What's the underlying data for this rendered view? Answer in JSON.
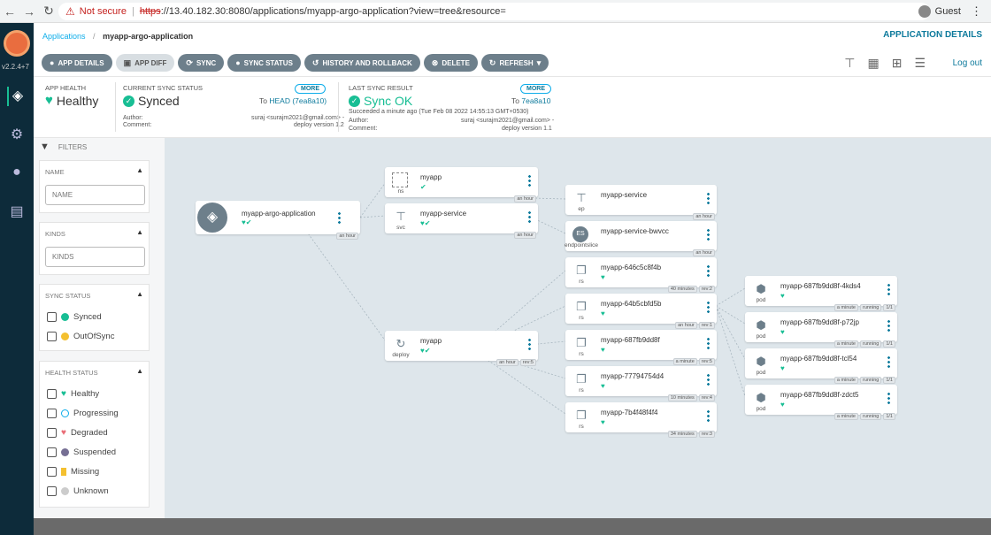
{
  "browser": {
    "warning": "Not secure",
    "url_scheme": "https",
    "url_rest": "://13.40.182.30:8080/applications/myapp-argo-application?view=tree&resource=",
    "profile": "Guest"
  },
  "sidebar": {
    "version": "v2.2.4+7"
  },
  "header": {
    "breadcrumb_root": "Applications",
    "breadcrumb_current": "myapp-argo-application",
    "section_title": "APPLICATION DETAILS",
    "logout": "Log out"
  },
  "toolbar": [
    "APP DETAILS",
    "APP DIFF",
    "SYNC",
    "SYNC STATUS",
    "HISTORY AND ROLLBACK",
    "DELETE",
    "REFRESH"
  ],
  "status": {
    "health_label": "APP HEALTH",
    "health_value": "Healthy",
    "sync_label": "CURRENT SYNC STATUS",
    "sync_value": "Synced",
    "sync_to": "To",
    "sync_head": "HEAD (7ea8a10)",
    "more": "MORE",
    "author_label": "Author:",
    "author_value": "suraj <surajm2021@gmail.com> -",
    "comment_label": "Comment:",
    "comment_value": "deploy version 1.2",
    "last_label": "LAST SYNC RESULT",
    "last_value": "Sync OK",
    "last_to": "7ea8a10",
    "last_succeeded": "Succeeded a minute ago (Tue Feb 08 2022 14:55:13 GMT+0530)",
    "last_author": "suraj <surajm2021@gmail.com> -",
    "last_comment": "deploy version 1.1"
  },
  "filters": {
    "title": "FILTERS",
    "name_title": "NAME",
    "name_placeholder": "NAME",
    "kinds_title": "KINDS",
    "kinds_placeholder": "KINDS",
    "sync_title": "SYNC STATUS",
    "sync_items": [
      "Synced",
      "OutOfSync"
    ],
    "health_title": "HEALTH STATUS",
    "health_items": [
      "Healthy",
      "Progressing",
      "Degraded",
      "Suspended",
      "Missing",
      "Unknown"
    ]
  },
  "graph": {
    "app": {
      "name": "myapp-argo-application",
      "age": "an hour"
    },
    "ns": {
      "name": "myapp",
      "kind": "ns",
      "age": "an hour"
    },
    "svc": {
      "name": "myapp-service",
      "kind": "svc",
      "age": "an hour"
    },
    "deploy": {
      "name": "myapp",
      "kind": "deploy",
      "age": "an hour",
      "rev": "rev:5"
    },
    "ep": {
      "name": "myapp-service",
      "kind": "ep",
      "age": "an hour"
    },
    "eps": {
      "name": "myapp-service-bwvcc",
      "kind": "endpointslice",
      "age": "an hour"
    },
    "rs": [
      {
        "name": "myapp-646c5c8f4b",
        "kind": "rs",
        "age": "40 minutes",
        "rev": "rev:2"
      },
      {
        "name": "myapp-64b5cbfd5b",
        "kind": "rs",
        "age": "an hour",
        "rev": "rev:1"
      },
      {
        "name": "myapp-687fb9dd8f",
        "kind": "rs",
        "age": "a minute",
        "rev": "rev:5"
      },
      {
        "name": "myapp-77794754d4",
        "kind": "rs",
        "age": "10 minutes",
        "rev": "rev:4"
      },
      {
        "name": "myapp-7b4f48f4f4",
        "kind": "rs",
        "age": "34 minutes",
        "rev": "rev:3"
      }
    ],
    "pods": [
      {
        "name": "myapp-687fb9dd8f-4kds4",
        "kind": "pod",
        "age": "a minute",
        "state": "running",
        "ready": "1/1"
      },
      {
        "name": "myapp-687fb9dd8f-p72jp",
        "kind": "pod",
        "age": "a minute",
        "state": "running",
        "ready": "1/1"
      },
      {
        "name": "myapp-687fb9dd8f-tcl54",
        "kind": "pod",
        "age": "a minute",
        "state": "running",
        "ready": "1/1"
      },
      {
        "name": "myapp-687fb9dd8f-zdct5",
        "kind": "pod",
        "age": "a minute",
        "state": "running",
        "ready": "1/1"
      }
    ]
  },
  "colors": {
    "healthy": "#18be94",
    "accent": "#0d7a9c",
    "nav": "#0d2b3a"
  }
}
